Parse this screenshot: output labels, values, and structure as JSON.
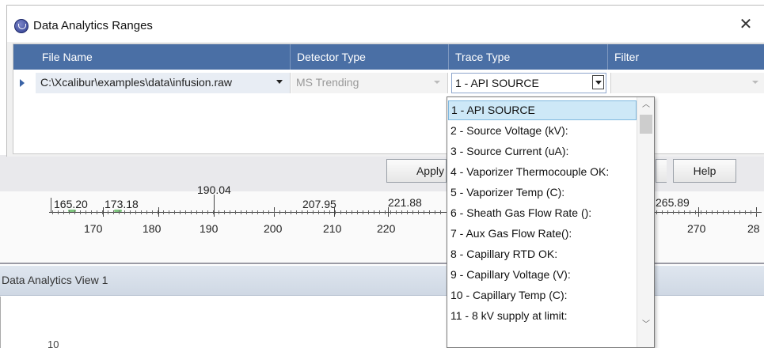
{
  "dialog": {
    "title": "Data Analytics Ranges",
    "close_glyph": "✕"
  },
  "grid": {
    "columns": [
      "File Name",
      "Detector Type",
      "Trace Type",
      "Filter"
    ],
    "row": {
      "file_name": "C:\\Xcalibur\\examples\\data\\infusion.raw",
      "detector_type": "MS Trending",
      "trace_type": "1 - API SOURCE",
      "filter": ""
    }
  },
  "trace_dropdown": {
    "selected_index": 0,
    "options": [
      "1 - API SOURCE",
      "2 - Source Voltage (kV):",
      "3 - Source Current (uA):",
      "4 - Vaporizer Thermocouple OK:",
      "5 - Vaporizer Temp (C):",
      "6 - Sheath Gas Flow Rate ():",
      "7 - Aux Gas Flow Rate():",
      "8 - Capillary RTD OK:",
      "9 - Capillary Voltage (V):",
      "10 - Capillary Temp (C):",
      "11 - 8 kV supply at limit:"
    ]
  },
  "buttons": {
    "apply": "Apply",
    "help": "Help"
  },
  "spectrum_scale": {
    "peaks": [
      "165.20",
      "173.18",
      "190.04",
      "207.95",
      "221.88",
      "265.89"
    ],
    "ticks": [
      "170",
      "180",
      "190",
      "200",
      "210",
      "220",
      "270",
      "28"
    ]
  },
  "view": {
    "title": "Data Analytics View  1",
    "y_label": "10"
  },
  "colors": {
    "header_blue": "#4a6fa5",
    "selection": "#cde8f7",
    "peak_green": "#7cc47c"
  }
}
